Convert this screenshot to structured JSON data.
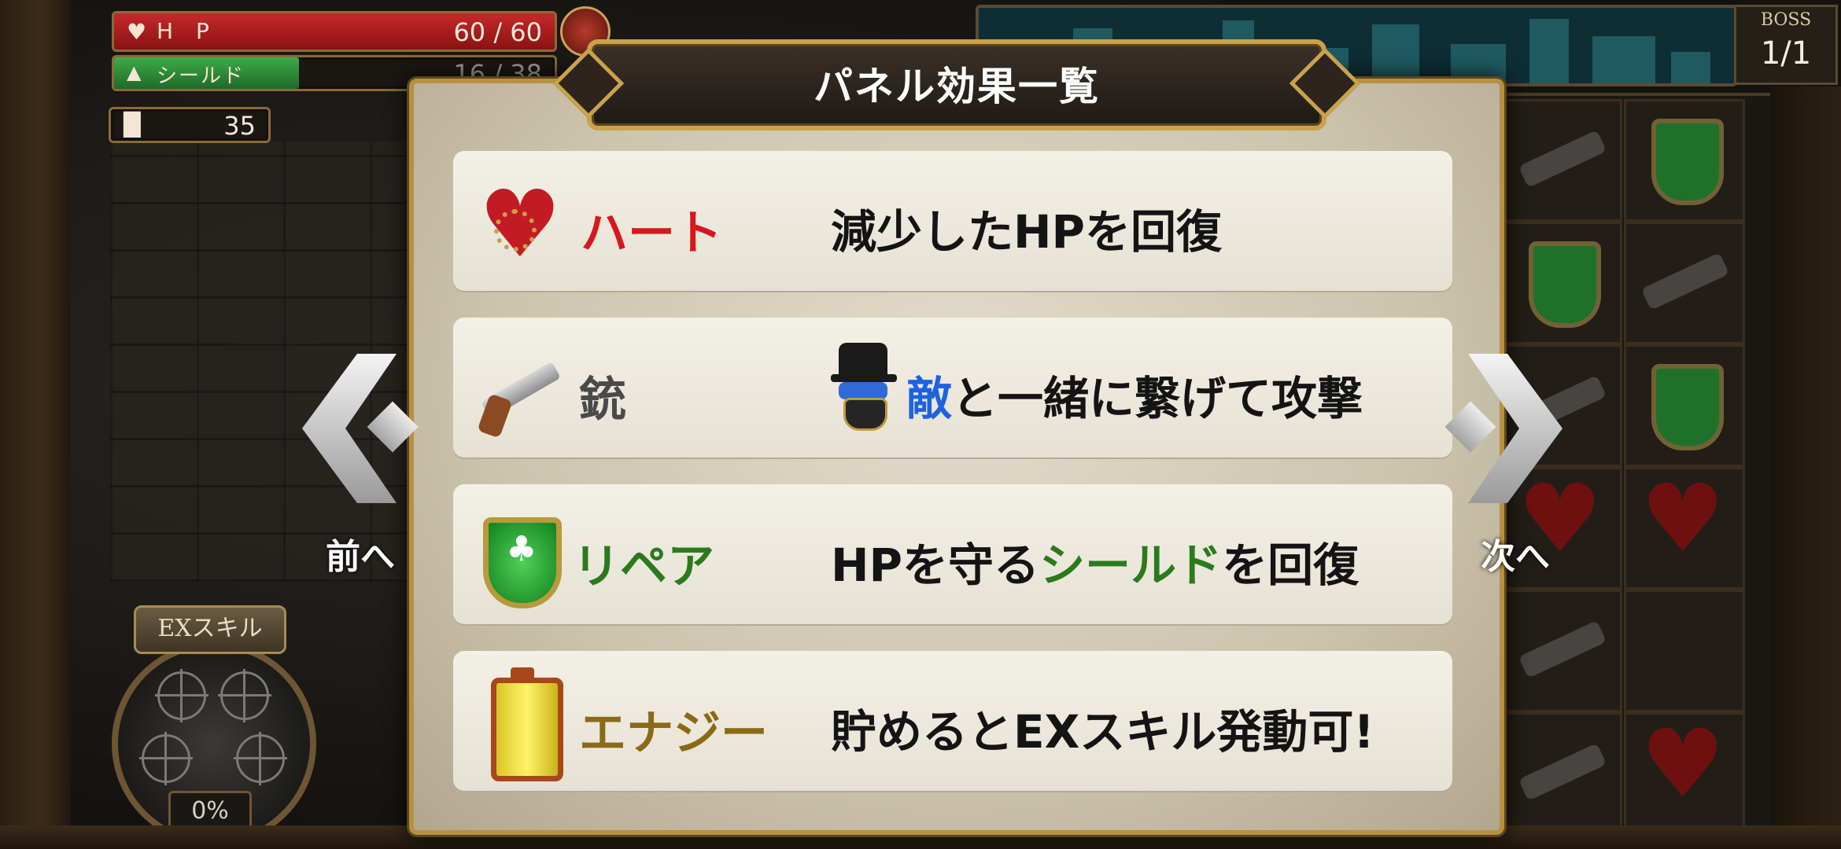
{
  "hud": {
    "hp_label": "H P",
    "hp_value": "60 / 60",
    "shield_label": "シールド",
    "shield_value": "16 / 38",
    "shield_ratio": 0.42,
    "ammo_value": "35",
    "boss_label": "BOSS",
    "boss_count": "1/1"
  },
  "ex_skill": {
    "title": "EXスキル",
    "percent": "0%"
  },
  "dialog": {
    "title": "パネル効果一覧",
    "rows": [
      {
        "icon": "heart-panel-icon",
        "name": "ハート",
        "name_color": "#d9161e",
        "desc_parts": [
          {
            "text": "減少したHPを回復",
            "color": "#141414"
          }
        ]
      },
      {
        "icon": "gun-panel-icon",
        "name": "銃",
        "name_color": "#4a4a4a",
        "desc_icon": "enemy-icon",
        "desc_parts": [
          {
            "text": "敵",
            "color": "#1f62e0"
          },
          {
            "text": "と一緒に繋げて攻撃",
            "color": "#141414"
          }
        ]
      },
      {
        "icon": "shield-panel-icon",
        "name": "リペア",
        "name_color": "#2b7a1d",
        "desc_parts": [
          {
            "text": "HPを守る",
            "color": "#141414"
          },
          {
            "text": "シールド",
            "color": "#2b7a1d"
          },
          {
            "text": "を回復",
            "color": "#141414"
          }
        ]
      },
      {
        "icon": "battery-panel-icon",
        "name": "エナジー",
        "name_color": "#8b6a16",
        "desc_parts": [
          {
            "text": "貯めるとEXスキル発動可!",
            "color": "#141414"
          }
        ]
      }
    ]
  },
  "nav": {
    "prev_label": "前へ",
    "next_label": "次へ"
  }
}
